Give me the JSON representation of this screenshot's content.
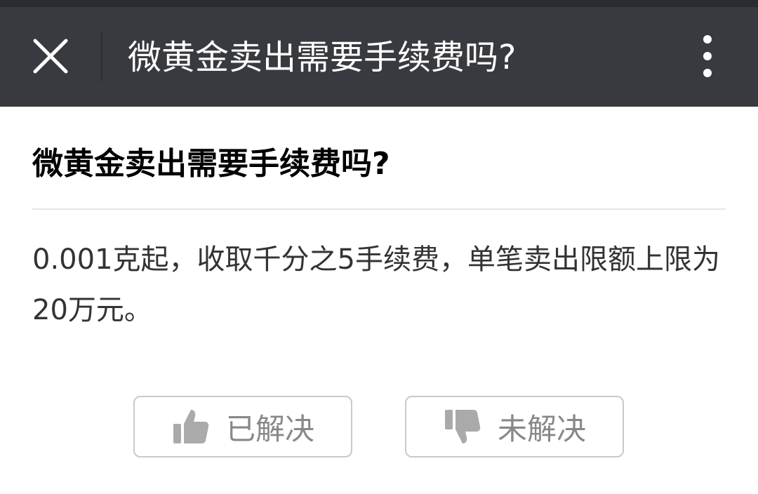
{
  "nav": {
    "title": "微黄金卖出需要手续费吗?",
    "close_icon": "close-icon",
    "more_icon": "more-vertical-icon"
  },
  "article": {
    "title": "微黄金卖出需要手续费吗?",
    "body": "0.001克起，收取千分之5手续费，单笔卖出限额上限为20万元。"
  },
  "feedback": {
    "resolved_label": "已解决",
    "resolved_icon": "thumbs-up-icon",
    "unresolved_label": "未解决",
    "unresolved_icon": "thumbs-down-icon"
  },
  "colors": {
    "nav_background": "#393a3f",
    "nav_text": "#ffffff",
    "body_text": "#333333",
    "button_border": "#c9c9c9",
    "button_text": "#888888"
  }
}
